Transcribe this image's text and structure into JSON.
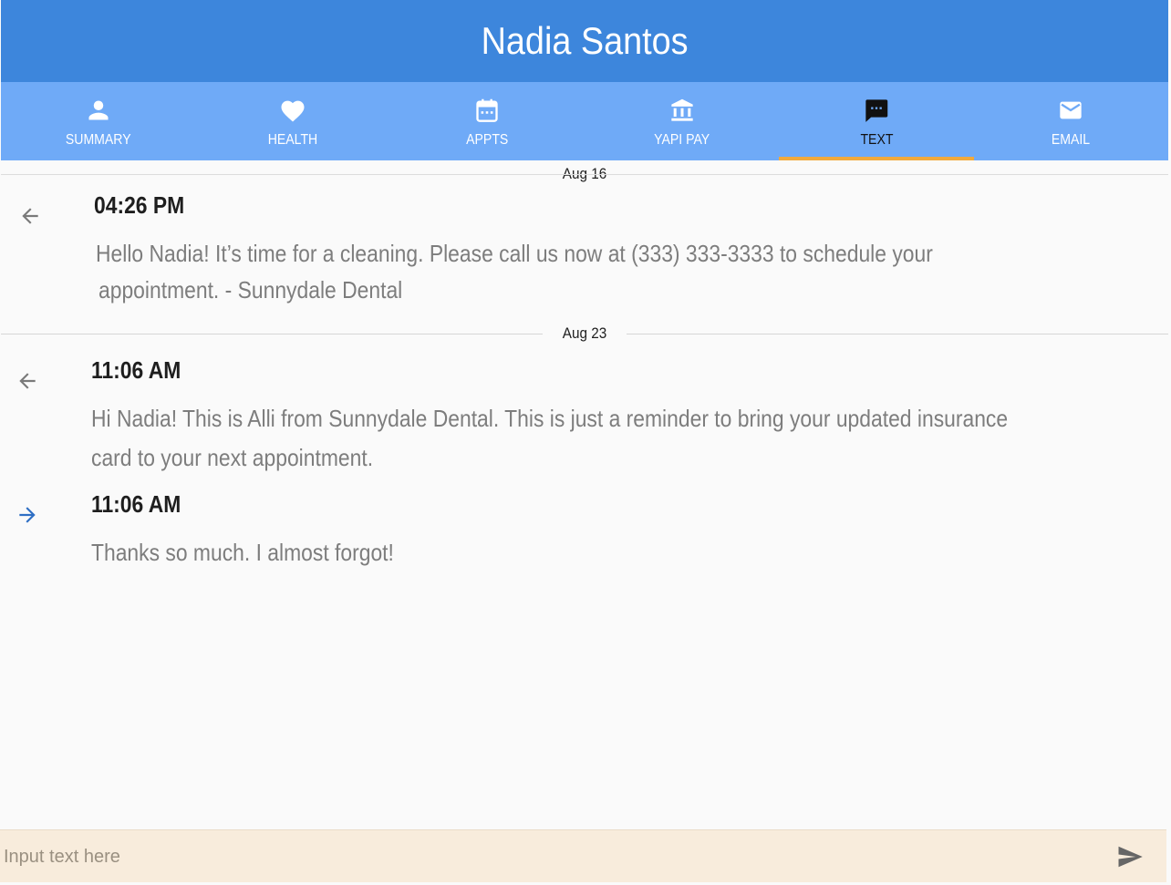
{
  "header": {
    "title": "Nadia Santos"
  },
  "tabs": [
    {
      "id": "summary",
      "label": "SUMMARY",
      "icon": "person-icon",
      "active": false
    },
    {
      "id": "health",
      "label": "HEALTH",
      "icon": "heart-icon",
      "active": false
    },
    {
      "id": "appts",
      "label": "APPTS",
      "icon": "calendar-icon",
      "active": false
    },
    {
      "id": "yapipay",
      "label": "YAPI PAY",
      "icon": "bank-icon",
      "active": false
    },
    {
      "id": "text",
      "label": "TEXT",
      "icon": "chat-bubble-icon",
      "active": true
    },
    {
      "id": "email",
      "label": "EMAIL",
      "icon": "envelope-icon",
      "active": false
    }
  ],
  "conversation": {
    "groups": [
      {
        "date": "Aug 16",
        "messages": [
          {
            "direction": "incoming",
            "time": "04:26 PM",
            "lines": [
              "Hello Nadia!  It’s time for a cleaning.  Please call us now at (333) 333-3333 to schedule your",
              "appointment.  - Sunnydale Dental"
            ]
          }
        ]
      },
      {
        "date": "Aug 23",
        "messages": [
          {
            "direction": "incoming",
            "time": "11:06 AM",
            "lines": [
              "Hi Nadia! This is Alli from Sunnydale Dental. This is just a reminder to bring your updated insurance",
              "card to your next appointment."
            ]
          },
          {
            "direction": "outgoing",
            "time": "11:06 AM",
            "lines": [
              "Thanks so much. I almost forgot!"
            ]
          }
        ]
      }
    ]
  },
  "composer": {
    "placeholder": "Input text here",
    "value": ""
  },
  "colors": {
    "header_bg": "#3d86dc",
    "tabbar_bg": "#6faaf7",
    "active_underline": "#f2a93b",
    "incoming_arrow": "#7a7a7a",
    "outgoing_arrow": "#2f6fc4",
    "composer_bg": "#f8ecdc"
  }
}
